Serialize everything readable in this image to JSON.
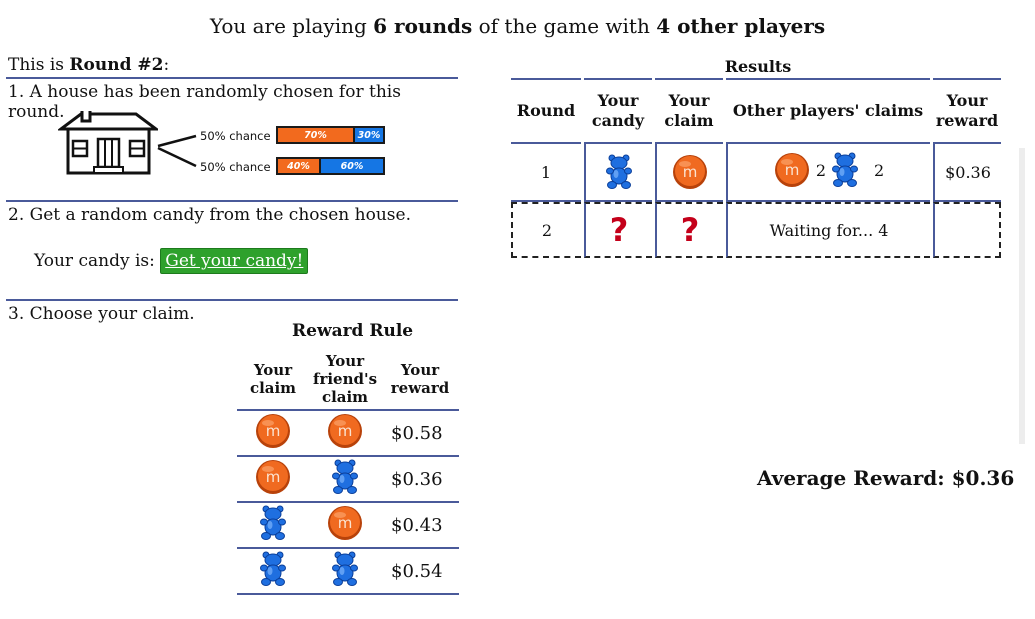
{
  "header": {
    "prefix": "You are playing ",
    "rounds": "6 rounds",
    "middle": " of the game with ",
    "players": "4 other players"
  },
  "left": {
    "round_prefix": "This is ",
    "round_label": "Round #2",
    "round_suffix": ":",
    "step1": "1.  A house has been randomly chosen for this round.",
    "house_options": [
      {
        "chance": "50% chance",
        "orange_label": "70%",
        "blue_label": "30%",
        "orange_share": 0.7
      },
      {
        "chance": "50% chance",
        "orange_label": "40%",
        "blue_label": "60%",
        "orange_share": 0.4
      }
    ],
    "step2": "2. Get a random candy from the chosen house.",
    "candy_prefix": "Your candy is:",
    "candy_button": "Get your candy!",
    "step3": "3. Choose your claim."
  },
  "reward_rule": {
    "title": "Reward Rule",
    "headers": [
      "Your claim",
      "Your friend's claim",
      "Your reward"
    ],
    "rows": [
      {
        "claim": "mm-candy-icon",
        "friend": "mm-candy-icon",
        "reward": "$0.58"
      },
      {
        "claim": "mm-candy-icon",
        "friend": "gummy-bear-icon",
        "reward": "$0.36"
      },
      {
        "claim": "gummy-bear-icon",
        "friend": "mm-candy-icon",
        "reward": "$0.43"
      },
      {
        "claim": "gummy-bear-icon",
        "friend": "gummy-bear-icon",
        "reward": "$0.54"
      }
    ]
  },
  "results": {
    "title": "Results",
    "headers": [
      "Round",
      "Your candy",
      "Your claim",
      "Other players' claims",
      "Your reward"
    ],
    "rows": [
      {
        "round": "1",
        "candy": "gummy-bear-icon",
        "claim": "mm-candy-icon",
        "mm_count": "2",
        "bear_count": "2",
        "reward": "$0.36"
      },
      {
        "round": "2",
        "candy": "?",
        "claim": "?",
        "others": "Waiting for... 4",
        "reward": ""
      }
    ]
  },
  "average": "Average Reward: $0.36",
  "colors": {
    "accent_line": "#4a5a9a",
    "orange": "#f26a1e",
    "blue": "#1576e4",
    "button_green": "#2ea12c",
    "question_red": "#c4001a"
  }
}
